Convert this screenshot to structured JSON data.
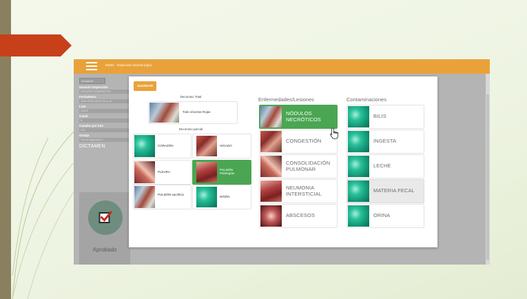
{
  "app": {
    "title": "INDIO · Inspección visceral (ojpo)",
    "colors": {
      "header": "#e9a23a",
      "selected": "#4aa652",
      "slide_accent": "#c8401a"
    }
  },
  "sidebar": {
    "refresh_label": "Actualizar",
    "fields": [
      {
        "label": "Usuario inspección",
        "value": "USUARIO ADMINISTRA"
      },
      {
        "label": "Fecha/Hora",
        "value": "18/11/2016 09:37:11 a. m."
      },
      {
        "label": "Lote",
        "value": "13012"
      },
      {
        "label": "Canal",
        "value": "5"
      },
      {
        "label": "Canales por lote",
        "value": "400"
      },
      {
        "label": "Granja",
        "value": "Cerdo Argentina 3"
      }
    ],
    "dictamen_label": "DICTAMEN",
    "verdict": "Aprobado"
  },
  "modal": {
    "save_label": "GUARDAR",
    "total": {
      "title": "Decomiso Total",
      "item": "Todo vísceras Rojas"
    },
    "partial": {
      "title": "Decomiso parcial",
      "items": [
        {
          "label": "CORAZÓN",
          "thumb": "teal",
          "selected": false
        },
        {
          "label": "HÍGADO",
          "thumb": "meat1",
          "selected": false
        },
        {
          "label": "PLEURA",
          "thumb": "meat2",
          "selected": false
        },
        {
          "label": "PULMÓN Patologías",
          "thumb": "meat3",
          "selected": true
        },
        {
          "label": "PULMÓN sacrificio",
          "thumb": "photo",
          "selected": false
        },
        {
          "label": "RIÑÓN",
          "thumb": "teal",
          "selected": false
        }
      ]
    },
    "diseases": {
      "title": "Enfermedades/Lesiones",
      "items": [
        {
          "label": "NÓDULOS NECRÓTICOS",
          "thumb": "photo",
          "selected": true
        },
        {
          "label": "CONGESTIÓN",
          "thumb": "meat1",
          "selected": false
        },
        {
          "label": "CONSOLIDACIÓN PULMONAR",
          "thumb": "meat2",
          "selected": false
        },
        {
          "label": "NEUMONIA INTERSTICIAL",
          "thumb": "meat3",
          "selected": false
        },
        {
          "label": "ABSCESOS",
          "thumb": "meat4",
          "selected": false
        }
      ]
    },
    "contaminations": {
      "title": "Contaminaciones",
      "items": [
        {
          "label": "BILIS",
          "thumb": "teal",
          "hover": false
        },
        {
          "label": "INGESTA",
          "thumb": "teal",
          "hover": false
        },
        {
          "label": "LECHE",
          "thumb": "teal",
          "hover": false
        },
        {
          "label": "MATERIA FECAL",
          "thumb": "teal",
          "hover": true
        },
        {
          "label": "ORINA",
          "thumb": "teal",
          "hover": false
        }
      ]
    }
  },
  "icons": {
    "menu": "hamburger-icon",
    "verdict": "checkbox-checked-icon",
    "pointer": "hand-pointer-icon"
  }
}
